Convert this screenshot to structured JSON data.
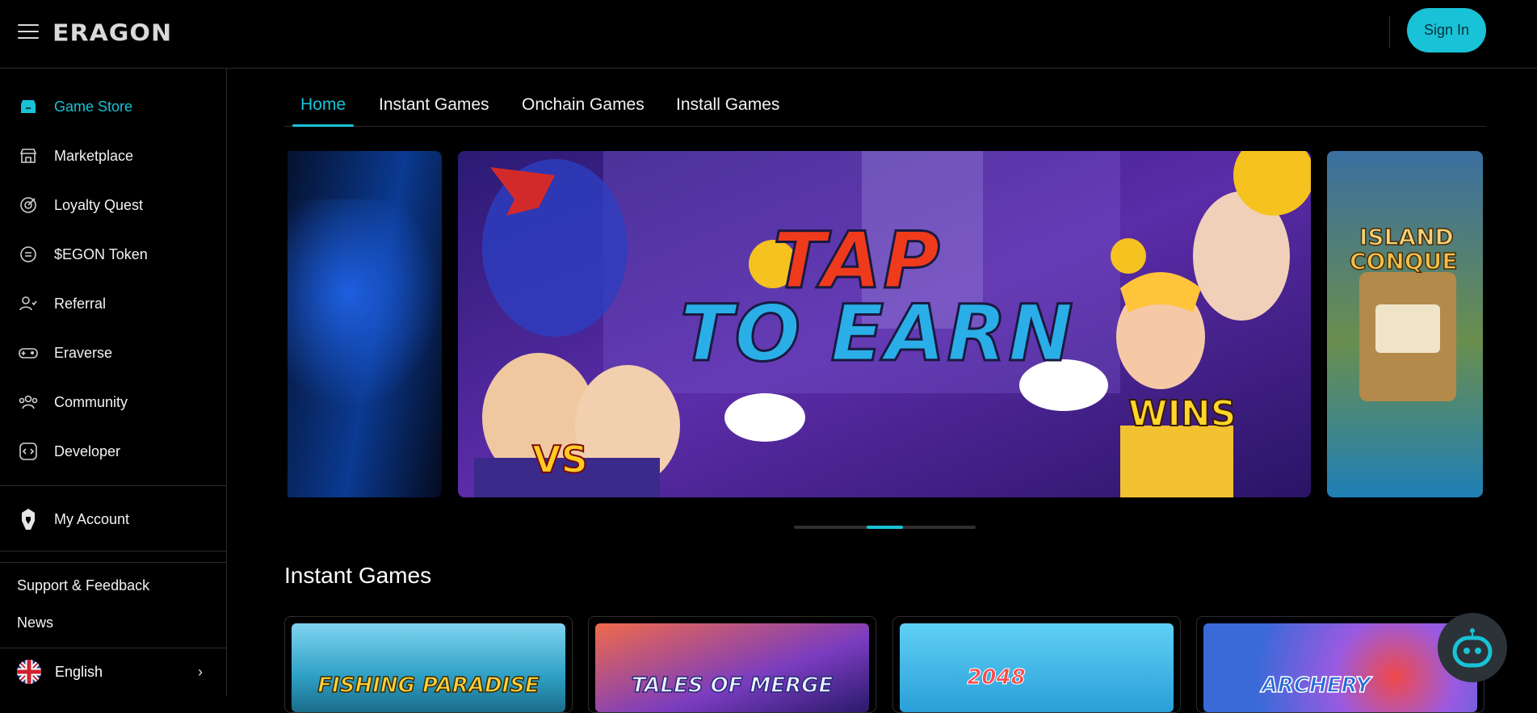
{
  "header": {
    "logo": "ERAGON",
    "sign_in_label": "Sign In"
  },
  "sidebar": {
    "items": [
      {
        "label": "Game Store",
        "icon": "store-icon",
        "active": true
      },
      {
        "label": "Marketplace",
        "icon": "marketplace-icon"
      },
      {
        "label": "Loyalty Quest",
        "icon": "quest-icon"
      },
      {
        "label": "$EGON Token",
        "icon": "token-icon"
      },
      {
        "label": "Referral",
        "icon": "referral-icon"
      },
      {
        "label": "Eraverse",
        "icon": "gamepad-icon"
      },
      {
        "label": "Community",
        "icon": "community-icon"
      },
      {
        "label": "Developer",
        "icon": "code-icon"
      }
    ],
    "account_label": "My Account",
    "links": [
      "Support & Feedback",
      "News"
    ],
    "language": "English"
  },
  "tabs": [
    {
      "label": "Home",
      "active": true
    },
    {
      "label": "Instant Games"
    },
    {
      "label": "Onchain Games"
    },
    {
      "label": "Install Games"
    }
  ],
  "carousel": {
    "main_banner": {
      "line1": "TAP",
      "line2": "TO EARN",
      "badge": "WINS",
      "vs": "VS"
    },
    "right_banner": {
      "line1": "ISLAND",
      "line2": "CONQUE"
    },
    "active_index": 1,
    "total": 4
  },
  "instant_games": {
    "title": "Instant Games",
    "cards": [
      {
        "title": "FISHING PARADISE",
        "bg": "#3a9bc2"
      },
      {
        "title": "TALES OF MERGE",
        "bg": "#6a4cb0"
      },
      {
        "title": "2048",
        "bg": "#2aa0d8"
      },
      {
        "title": "ARCHERY",
        "bg": "#4a7fd8"
      }
    ]
  },
  "colors": {
    "accent": "#19c2d6",
    "background": "#000000"
  }
}
